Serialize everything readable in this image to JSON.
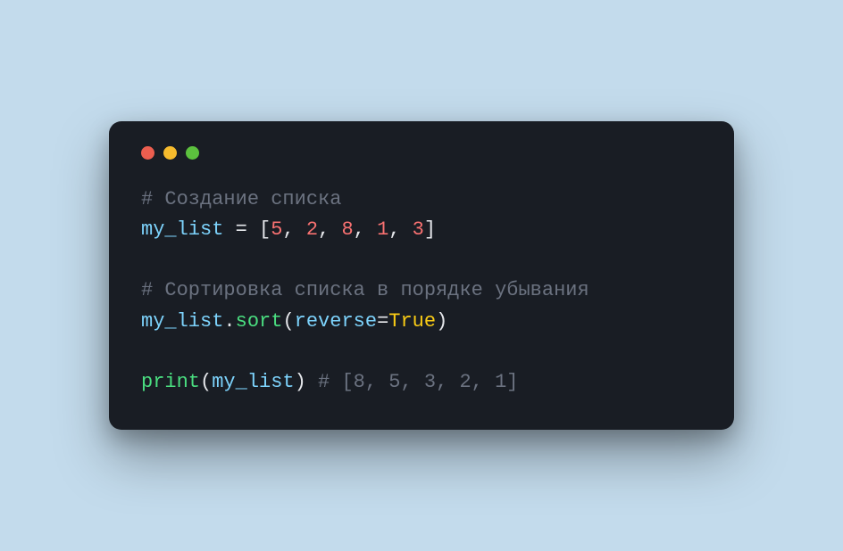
{
  "colors": {
    "background": "#c3dbec",
    "window_bg": "#191d24",
    "dot_red": "#ec5e4f",
    "dot_yellow": "#f6bb2d",
    "dot_green": "#5cc13e",
    "comment": "#6b7280",
    "variable": "#7dd3fc",
    "operator": "#e5e7eb",
    "number": "#f87171",
    "method": "#4ade80",
    "boolean": "#facc15"
  },
  "code": {
    "line1_comment": "# Создание списка",
    "line2_var": "my_list",
    "line2_space_eq": " ",
    "line2_eq": "=",
    "line2_space_after": " ",
    "line2_open": "[",
    "line2_n1": "5",
    "line2_c1": ", ",
    "line2_n2": "2",
    "line2_c2": ", ",
    "line2_n3": "8",
    "line2_c3": ", ",
    "line2_n4": "1",
    "line2_c4": ", ",
    "line2_n5": "3",
    "line2_close": "]",
    "blank1": "",
    "line4_comment": "# Сортировка списка в порядке убывания",
    "line5_var": "my_list",
    "line5_dot": ".",
    "line5_method": "sort",
    "line5_open": "(",
    "line5_arg": "reverse",
    "line5_eq": "=",
    "line5_bool": "True",
    "line5_close": ")",
    "blank2": "",
    "line7_fn": "print",
    "line7_open": "(",
    "line7_var": "my_list",
    "line7_close": ")",
    "line7_space": " ",
    "line7_comment": "# [8, 5, 3, 2, 1]"
  }
}
